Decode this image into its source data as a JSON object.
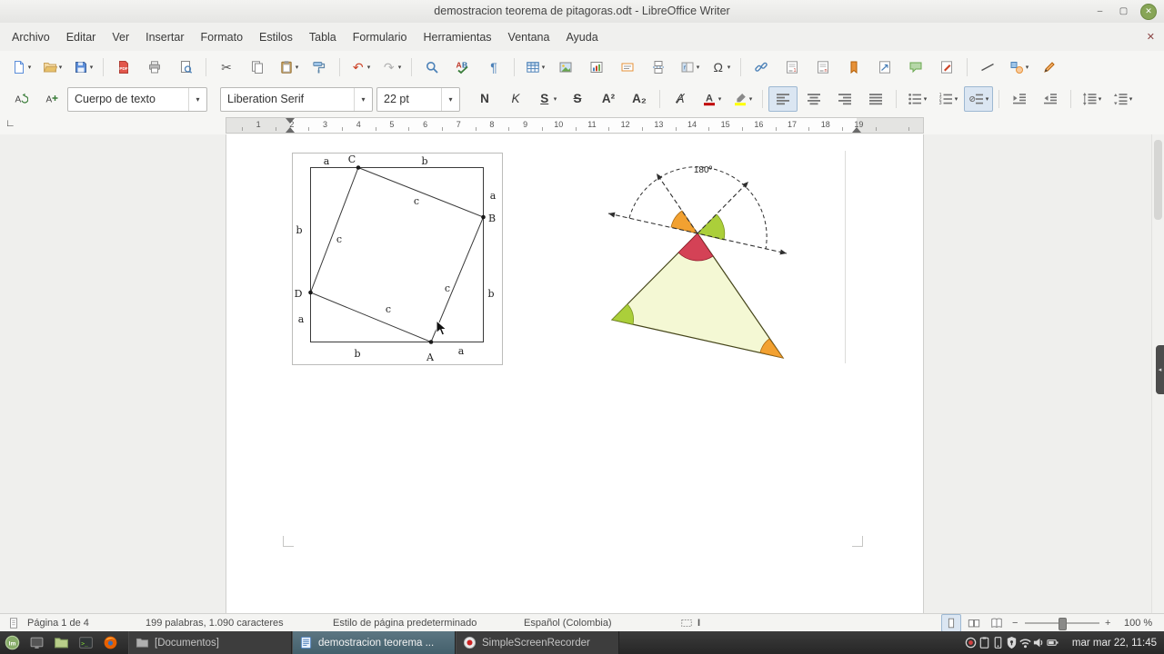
{
  "window": {
    "title": "demostracion teorema de pitagoras.odt - LibreOffice Writer",
    "controls": [
      {
        "name": "minimize",
        "glyph": "–"
      },
      {
        "name": "maximize",
        "glyph": "▢"
      },
      {
        "name": "close",
        "glyph": "✕"
      }
    ]
  },
  "menubar": {
    "items": [
      "Archivo",
      "Editar",
      "Ver",
      "Insertar",
      "Formato",
      "Estilos",
      "Tabla",
      "Formulario",
      "Herramientas",
      "Ventana",
      "Ayuda"
    ],
    "close_document_glyph": "✕"
  },
  "standard_toolbar": {
    "items": [
      {
        "name": "new-document",
        "icon": "newdoc",
        "dropdown": true
      },
      {
        "name": "open",
        "icon": "openFolder",
        "dropdown": true
      },
      {
        "name": "save",
        "icon": "save",
        "dropdown": true
      },
      {
        "sep": true
      },
      {
        "name": "export-pdf",
        "icon": "pdf"
      },
      {
        "name": "print",
        "icon": "printer"
      },
      {
        "name": "print-preview",
        "icon": "preview"
      },
      {
        "sep": true
      },
      {
        "name": "cut",
        "glyph": "✂",
        "color": "#555555"
      },
      {
        "name": "copy",
        "icon": "copyIcon"
      },
      {
        "name": "paste",
        "icon": "pasteIcon",
        "dropdown": true
      },
      {
        "name": "clone-formatting",
        "icon": "cloneIcon"
      },
      {
        "sep": true
      },
      {
        "name": "undo",
        "glyph": "↶",
        "color": "#cc4125",
        "dropdown": true
      },
      {
        "name": "redo",
        "glyph": "↷",
        "color": "#b0b0b0",
        "dropdown": true
      },
      {
        "sep": true
      },
      {
        "name": "find-replace",
        "icon": "magnifier"
      },
      {
        "name": "spelling",
        "icon": "spelling"
      },
      {
        "name": "formatting-marks",
        "glyph": "¶",
        "color": "#4d82b8"
      },
      {
        "sep": true
      },
      {
        "name": "insert-table",
        "icon": "table",
        "dropdown": true
      },
      {
        "name": "insert-image",
        "icon": "image"
      },
      {
        "name": "insert-chart",
        "icon": "chart"
      },
      {
        "name": "insert-text-box",
        "icon": "textbox"
      },
      {
        "name": "insert-page-break",
        "icon": "pagebreak"
      },
      {
        "name": "insert-field",
        "icon": "field",
        "dropdown": true
      },
      {
        "name": "insert-special-character",
        "glyph": "Ω",
        "color": "#444444",
        "dropdown": true
      },
      {
        "sep": true
      },
      {
        "name": "insert-hyperlink",
        "icon": "hyperlink"
      },
      {
        "name": "insert-footnote",
        "icon": "footnote"
      },
      {
        "name": "insert-endnote",
        "icon": "endnote"
      },
      {
        "name": "insert-bookmark",
        "icon": "bookmark"
      },
      {
        "name": "insert-cross-reference",
        "icon": "crossref"
      },
      {
        "name": "insert-comment",
        "icon": "comment"
      },
      {
        "name": "track-changes",
        "icon": "trackchanges"
      },
      {
        "sep": true
      },
      {
        "name": "insert-line",
        "icon": "lineIcon"
      },
      {
        "name": "basic-shapes",
        "icon": "shapes",
        "dropdown": true
      },
      {
        "name": "draw-functions",
        "icon": "pencil"
      }
    ]
  },
  "formatting_toolbar": {
    "paragraph_style": "Cuerpo de texto",
    "font_name": "Liberation Serif",
    "font_size": "22 pt",
    "buttons": [
      {
        "name": "update-style",
        "icon": "styleUpdate"
      },
      {
        "name": "new-style",
        "icon": "styleNew"
      },
      {
        "combo": "style"
      },
      {
        "combo": "font"
      },
      {
        "combo": "size"
      },
      {
        "name": "bold",
        "glyph": "N",
        "cls": "b"
      },
      {
        "name": "italic",
        "glyph": "K",
        "cls": "i"
      },
      {
        "name": "underline",
        "glyph": "S",
        "cls": "u",
        "dropdown": true
      },
      {
        "name": "strikethrough",
        "glyph": "S",
        "cls": "st"
      },
      {
        "name": "superscript",
        "glyph": "A²",
        "cls": "b"
      },
      {
        "name": "subscript",
        "glyph": "A₂",
        "cls": "b"
      },
      {
        "sep": true
      },
      {
        "name": "clear-formatting",
        "glyph": "Ⱥ",
        "cls": "i"
      },
      {
        "name": "font-color",
        "icon": "fontColor",
        "dropdown": true
      },
      {
        "name": "highlight-color",
        "icon": "highlight",
        "dropdown": true
      },
      {
        "sep": true
      },
      {
        "name": "align-left",
        "icon": "alignL",
        "active": true
      },
      {
        "name": "align-center",
        "icon": "alignC"
      },
      {
        "name": "align-right",
        "icon": "alignR"
      },
      {
        "name": "align-justify",
        "icon": "alignJ"
      },
      {
        "sep": true
      },
      {
        "name": "unordered-list",
        "icon": "ulist",
        "dropdown": true
      },
      {
        "name": "ordered-list",
        "icon": "olist",
        "dropdown": true
      },
      {
        "name": "no-list",
        "icon": "nolist",
        "active": true,
        "dropdown": true
      },
      {
        "sep": true
      },
      {
        "name": "increase-indent",
        "icon": "indinc"
      },
      {
        "name": "decrease-indent",
        "icon": "inddec"
      },
      {
        "sep": true
      },
      {
        "name": "line-spacing",
        "icon": "lspace",
        "dropdown": true
      },
      {
        "name": "paragraph-spacing",
        "icon": "pspace",
        "dropdown": true
      }
    ]
  },
  "ruler": {
    "numbers": [
      "1",
      "2",
      "3",
      "4",
      "5",
      "6",
      "7",
      "8",
      "9",
      "10",
      "11",
      "12",
      "13",
      "14",
      "15",
      "16",
      "17",
      "18",
      "19"
    ]
  },
  "figures": {
    "pythagoras": {
      "labels": {
        "tl": "a",
        "tv": "C",
        "tr": "b",
        "rt": "a",
        "rv": "B",
        "rb": "b",
        "lt": "b",
        "lv": "D",
        "lb": "a",
        "bl": "b",
        "bv": "A",
        "br": "a",
        "c_top": "c",
        "c_left": "c",
        "c_right": "c",
        "c_bottom": "c"
      }
    },
    "triangle": {
      "labels": {
        "sum": "180º"
      }
    }
  },
  "status_bar": {
    "page": "Página 1 de 4",
    "words": "199 palabras, 1.090 caracteres",
    "page_style": "Estilo de página predeterminado",
    "language": "Español (Colombia)",
    "insert_indicator": "I",
    "zoom_level": "100 %"
  },
  "taskbar": {
    "launchers": [
      {
        "name": "mint-menu",
        "icon": "mintMenu"
      },
      {
        "name": "show-desktop",
        "icon": "showDesktop"
      },
      {
        "name": "file-manager",
        "icon": "folderGreen"
      },
      {
        "name": "terminal",
        "icon": "terminal"
      },
      {
        "name": "web-browser",
        "icon": "browser"
      }
    ],
    "windows": [
      {
        "label": "[Documentos]",
        "icon": "folderWin",
        "active": false
      },
      {
        "label": "demostracion teorema ...",
        "icon": "writerDoc",
        "active": true
      },
      {
        "label": "SimpleScreenRecorder",
        "icon": "recorder",
        "active": false
      }
    ],
    "tray": [
      {
        "name": "screen-recorder-tray",
        "icon": "recDot"
      },
      {
        "name": "clipboard-manager",
        "icon": "clipboardTray"
      },
      {
        "name": "phone-connect",
        "icon": "phoneTray"
      },
      {
        "name": "update-shield",
        "icon": "shieldTray"
      },
      {
        "name": "network",
        "icon": "wifiTray"
      },
      {
        "name": "volume",
        "icon": "volumeTray"
      },
      {
        "name": "battery",
        "icon": "batteryTray"
      }
    ],
    "clock": "mar mar 22, 11:45"
  },
  "colors": {
    "active_button_bg": "#dbe6f2",
    "taskbar_active": "#51707e",
    "close_button_green": "#87a556",
    "font_color_bar": "#c00000",
    "highlight_bar": "#ffff00",
    "triangle_fill": "#f4f8d4",
    "wedge_red": "#d44256",
    "wedge_orange": "#f2a131",
    "wedge_green": "#abcf3a"
  }
}
